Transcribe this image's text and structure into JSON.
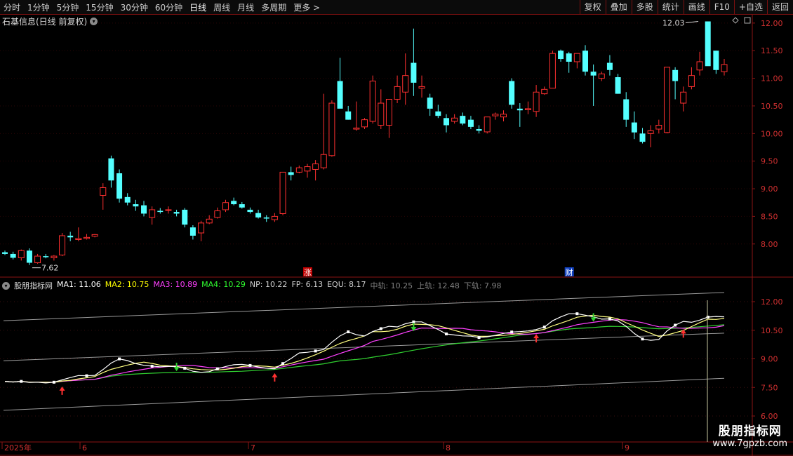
{
  "toolbar": {
    "periods": [
      "分时",
      "1分钟",
      "5分钟",
      "15分钟",
      "30分钟",
      "60分钟",
      "日线",
      "周线",
      "月线",
      "多周期",
      "更多 >"
    ],
    "active": "日线",
    "right_buttons": [
      "复权",
      "叠加",
      "多股",
      "统计",
      "画线",
      "F10",
      "+自选",
      "返回"
    ]
  },
  "stock": {
    "name": "石基信息(日线 前复权)"
  },
  "main_chart": {
    "y_ticks": [
      "12.00",
      "11.50",
      "11.00",
      "10.50",
      "10.00",
      "9.50",
      "9.00",
      "8.50",
      "8.00"
    ],
    "high_label": "12.03",
    "low_label": "7.62",
    "markers": [
      "",
      "涨",
      "财"
    ],
    "up_color": "#ff3030",
    "down_color": "#54ffff"
  },
  "indicator": {
    "name": "股朋指标网",
    "items": [
      {
        "label": "MA1: 11.06",
        "color": "#ffffff"
      },
      {
        "label": "MA2: 10.75",
        "color": "#ffff00"
      },
      {
        "label": "MA3: 10.89",
        "color": "#ff40ff"
      },
      {
        "label": "MA4: 10.29",
        "color": "#30ff30"
      },
      {
        "label": "NP: 10.22",
        "color": "#d0d0d0"
      },
      {
        "label": "FP: 6.13",
        "color": "#d0d0d0"
      },
      {
        "label": "EQU: 8.17",
        "color": "#d0d0d0"
      },
      {
        "label": "中轨: 10.25",
        "color": "#808080"
      },
      {
        "label": "上轨: 12.48",
        "color": "#808080"
      },
      {
        "label": "下轨: 7.98",
        "color": "#808080"
      }
    ],
    "y_ticks": [
      "12.00",
      "10.50",
      "9.00",
      "7.50",
      "6.00"
    ]
  },
  "x_axis": {
    "labels": [
      "2025年",
      "6",
      "7",
      "8",
      "9"
    ]
  },
  "watermark": {
    "title": "股朋指标网",
    "url": "www.7gpzb.com"
  },
  "chart_data": {
    "type": "candlestick",
    "candles": [
      [
        7.85,
        7.88,
        7.8,
        7.82
      ],
      [
        7.82,
        7.86,
        7.72,
        7.75
      ],
      [
        7.75,
        7.9,
        7.7,
        7.88
      ],
      [
        7.88,
        7.92,
        7.62,
        7.66
      ],
      [
        7.66,
        7.82,
        7.64,
        7.78
      ],
      [
        7.78,
        7.82,
        7.74,
        7.76
      ],
      [
        7.75,
        7.8,
        7.7,
        7.78
      ],
      [
        7.8,
        8.2,
        7.78,
        8.15
      ],
      [
        8.15,
        8.22,
        8.05,
        8.12
      ],
      [
        8.08,
        8.3,
        8.05,
        8.1
      ],
      [
        8.1,
        8.18,
        8.08,
        8.12
      ],
      [
        8.14,
        8.18,
        8.12,
        8.17
      ],
      [
        8.88,
        9.1,
        8.62,
        9.02
      ],
      [
        9.55,
        9.6,
        9.02,
        9.15
      ],
      [
        9.28,
        9.35,
        8.75,
        8.82
      ],
      [
        8.85,
        8.92,
        8.7,
        8.75
      ],
      [
        8.72,
        8.8,
        8.6,
        8.68
      ],
      [
        8.7,
        8.78,
        8.5,
        8.55
      ],
      [
        8.48,
        8.68,
        8.35,
        8.62
      ],
      [
        8.6,
        8.65,
        8.55,
        8.58
      ],
      [
        8.62,
        8.68,
        8.55,
        8.62
      ],
      [
        8.58,
        8.62,
        8.5,
        8.55
      ],
      [
        8.62,
        8.65,
        8.3,
        8.35
      ],
      [
        8.3,
        8.34,
        8.08,
        8.15
      ],
      [
        8.2,
        8.42,
        8.05,
        8.38
      ],
      [
        8.38,
        8.52,
        8.36,
        8.45
      ],
      [
        8.48,
        8.66,
        8.46,
        8.6
      ],
      [
        8.62,
        8.8,
        8.58,
        8.75
      ],
      [
        8.78,
        8.84,
        8.7,
        8.72
      ],
      [
        8.72,
        8.76,
        8.64,
        8.66
      ],
      [
        8.62,
        8.66,
        8.55,
        8.58
      ],
      [
        8.56,
        8.62,
        8.46,
        8.48
      ],
      [
        8.48,
        8.52,
        8.4,
        8.46
      ],
      [
        8.44,
        8.56,
        8.4,
        8.5
      ],
      [
        8.55,
        9.12,
        8.52,
        9.3
      ],
      [
        9.3,
        9.4,
        9.15,
        9.25
      ],
      [
        9.3,
        9.42,
        9.28,
        9.38
      ],
      [
        9.32,
        9.45,
        9.2,
        9.4
      ],
      [
        9.35,
        9.52,
        9.15,
        9.45
      ],
      [
        9.38,
        10.72,
        9.35,
        9.62
      ],
      [
        9.6,
        10.6,
        9.58,
        10.55
      ],
      [
        10.95,
        11.37,
        10.5,
        10.45
      ],
      [
        10.4,
        10.5,
        10.25,
        10.25
      ],
      [
        10.08,
        10.58,
        10.05,
        10.1
      ],
      [
        10.12,
        10.28,
        10.08,
        10.25
      ],
      [
        10.22,
        11.05,
        10.18,
        10.95
      ],
      [
        10.15,
        10.8,
        10.08,
        10.55
      ],
      [
        10.15,
        10.62,
        9.92,
        10.62
      ],
      [
        10.62,
        11.05,
        10.55,
        10.85
      ],
      [
        10.75,
        11.45,
        10.52,
        11.05
      ],
      [
        11.28,
        11.9,
        10.68,
        10.92
      ],
      [
        10.82,
        11.05,
        10.65,
        10.85
      ],
      [
        10.65,
        10.72,
        10.32,
        10.45
      ],
      [
        10.4,
        10.52,
        10.28,
        10.32
      ],
      [
        10.28,
        10.35,
        10.02,
        10.15
      ],
      [
        10.22,
        10.35,
        10.18,
        10.28
      ],
      [
        10.32,
        10.38,
        10.15,
        10.18
      ],
      [
        10.25,
        10.32,
        10.08,
        10.12
      ],
      [
        10.08,
        10.15,
        10.0,
        10.05
      ],
      [
        10.03,
        10.3,
        10.0,
        10.3
      ],
      [
        10.32,
        10.38,
        10.25,
        10.35
      ],
      [
        10.3,
        10.42,
        10.22,
        10.35
      ],
      [
        10.95,
        11.0,
        10.45,
        10.52
      ],
      [
        10.45,
        10.55,
        10.12,
        10.42
      ],
      [
        10.43,
        10.58,
        10.35,
        10.45
      ],
      [
        10.4,
        10.88,
        10.3,
        10.75
      ],
      [
        10.72,
        10.85,
        10.7,
        10.8
      ],
      [
        10.82,
        11.5,
        10.82,
        11.45
      ],
      [
        11.5,
        11.52,
        11.3,
        11.35
      ],
      [
        11.45,
        11.48,
        11.1,
        11.3
      ],
      [
        11.3,
        11.42,
        11.18,
        11.45
      ],
      [
        11.5,
        11.6,
        11.05,
        11.12
      ],
      [
        11.12,
        11.25,
        10.5,
        11.05
      ],
      [
        11.0,
        11.12,
        10.95,
        11.08
      ],
      [
        11.28,
        11.42,
        11.05,
        11.15
      ],
      [
        11.02,
        11.08,
        10.72,
        10.72
      ],
      [
        10.62,
        10.75,
        10.12,
        10.25
      ],
      [
        10.2,
        10.4,
        9.9,
        10.02
      ],
      [
        10.0,
        10.1,
        9.82,
        9.85
      ],
      [
        10.0,
        10.15,
        9.75,
        10.05
      ],
      [
        10.08,
        10.25,
        10.0,
        10.15
      ],
      [
        10.02,
        11.2,
        10.0,
        11.2
      ],
      [
        11.15,
        11.2,
        10.62,
        10.95
      ],
      [
        10.55,
        10.85,
        10.4,
        10.75
      ],
      [
        10.85,
        11.2,
        10.8,
        11.05
      ],
      [
        11.15,
        11.48,
        11.05,
        11.3
      ],
      [
        12.03,
        12.03,
        11.25,
        11.22
      ],
      [
        11.5,
        11.5,
        11.08,
        11.15
      ],
      [
        11.12,
        11.35,
        11.05,
        11.25
      ]
    ],
    "y_range": [
      7.4,
      12.1
    ]
  }
}
